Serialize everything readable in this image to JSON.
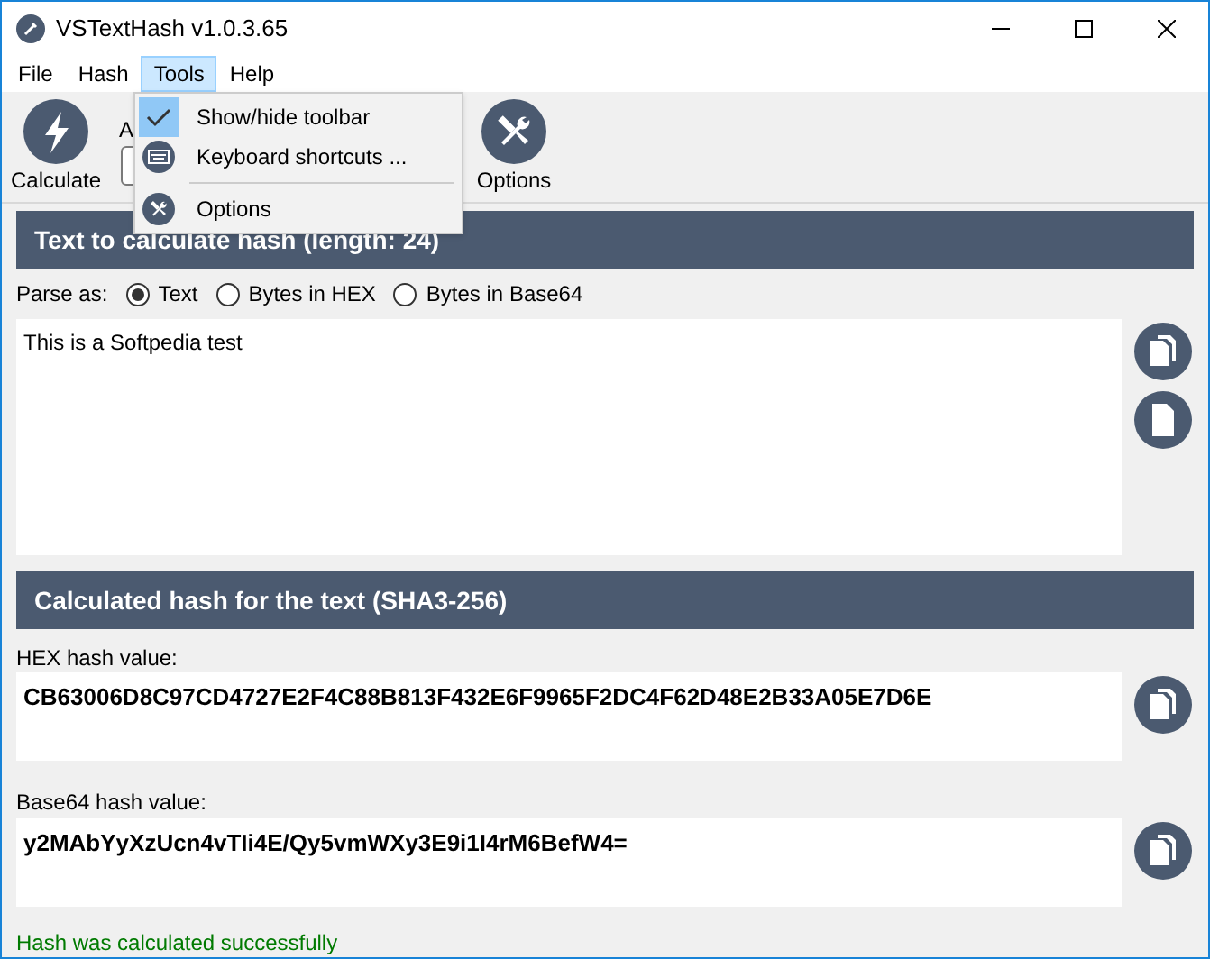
{
  "window": {
    "title": "VSTextHash v1.0.3.65"
  },
  "menu": [
    {
      "label": "File",
      "selected": false
    },
    {
      "label": "Hash",
      "selected": false
    },
    {
      "label": "Tools",
      "selected": true
    },
    {
      "label": "Help",
      "selected": false
    }
  ],
  "toolbar": {
    "calculate": "Calculate",
    "algorithm_label": "A",
    "options": "Options"
  },
  "dropdown": [
    {
      "kind": "item",
      "label": "Show/hide toolbar",
      "checked": true
    },
    {
      "kind": "item",
      "label": "Keyboard shortcuts ...",
      "checked": false
    },
    {
      "kind": "separator"
    },
    {
      "kind": "item",
      "label": "Options",
      "checked": false
    }
  ],
  "input_section": {
    "header": "Text to calculate hash (length: 24)",
    "parse_label": "Parse as:",
    "parse_options": [
      {
        "label": "Text",
        "selected": true
      },
      {
        "label": "Bytes in HEX",
        "selected": false
      },
      {
        "label": "Bytes in Base64",
        "selected": false
      }
    ],
    "text": "This is a Softpedia test"
  },
  "result_section": {
    "header": "Calculated hash for the text (SHA3-256)",
    "hex_label": "HEX hash value:",
    "hex_value": "CB63006D8C97CD4727E2F4C88B813F432E6F9965F2DC4F62D48E2B33A05E7D6E",
    "base64_label": "Base64 hash value:",
    "base64_value": "y2MAbYyXzUcn4vTIi4E/Qy5vmWXy3E9i1I4rM6BefW4="
  },
  "status_bar": "Hash was calculated successfully"
}
